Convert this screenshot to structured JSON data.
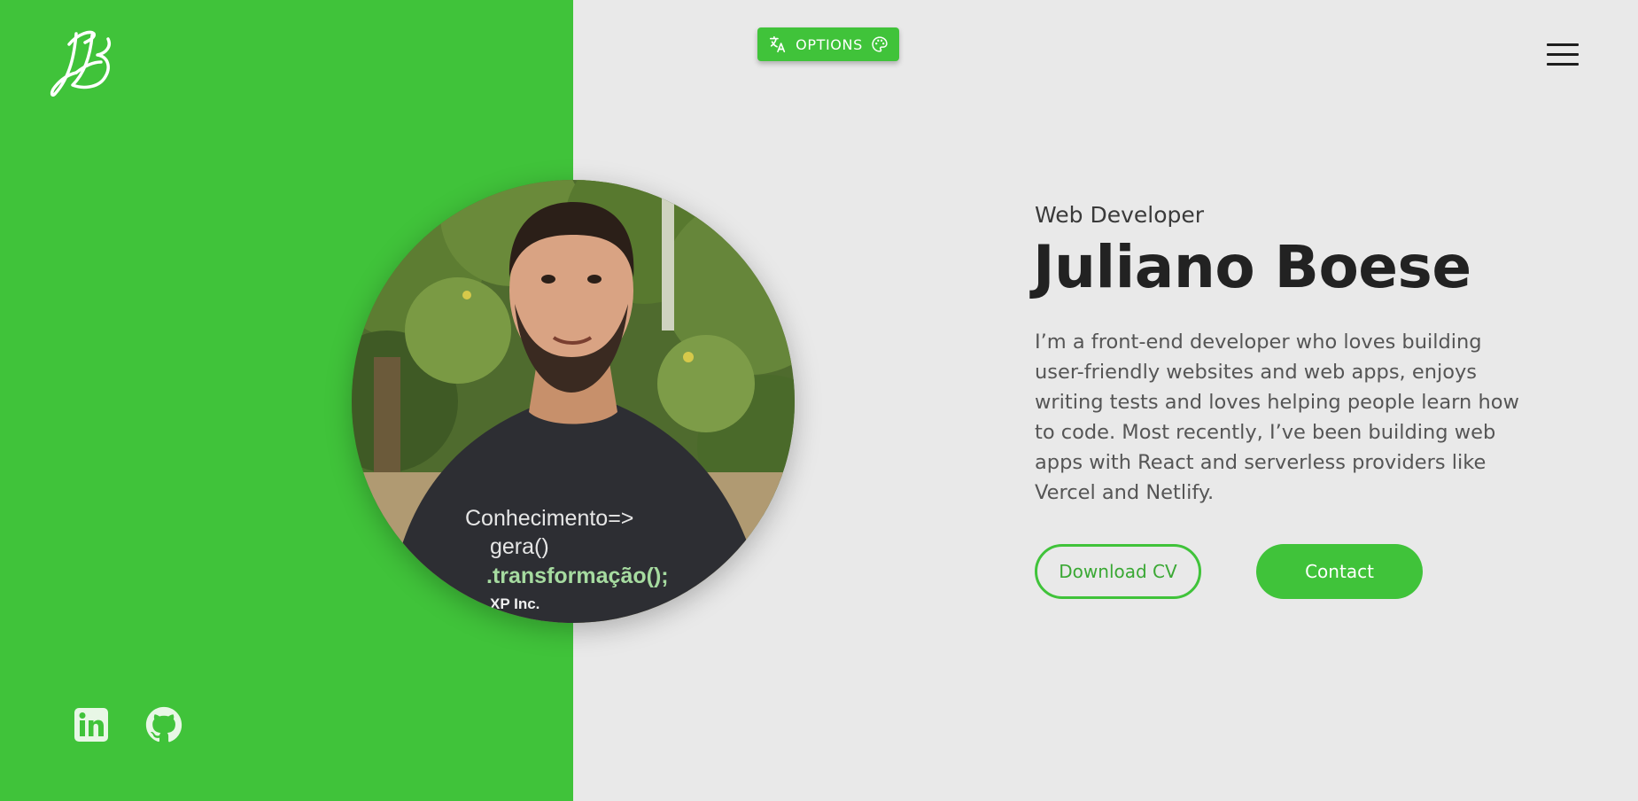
{
  "colors": {
    "accent": "#40c33a",
    "background": "#e9e9e9",
    "text_dark": "#222222",
    "text_body": "#555555"
  },
  "header": {
    "logo_icon": "signature-logo-icon",
    "options_label": "OPTIONS",
    "options_left_icon": "translate-icon",
    "options_right_icon": "palette-icon",
    "menu_icon": "hamburger-menu-icon"
  },
  "hero": {
    "subtitle": "Web Developer",
    "name": "Juliano Boese",
    "bio": "I’m a front-end developer who loves building user-friendly websites and web apps, enjoys writing tests and loves helping people learn how to code. Most recently, I’ve been building web apps with React and serverless providers like Vercel and Netlify.",
    "download_label": "Download CV",
    "contact_label": "Contact",
    "photo_shirt_text": [
      "Conhecimento=>",
      "gera()",
      ".transformação();",
      "XP Inc."
    ]
  },
  "social": [
    {
      "icon": "linkedin-icon"
    },
    {
      "icon": "github-icon"
    }
  ]
}
